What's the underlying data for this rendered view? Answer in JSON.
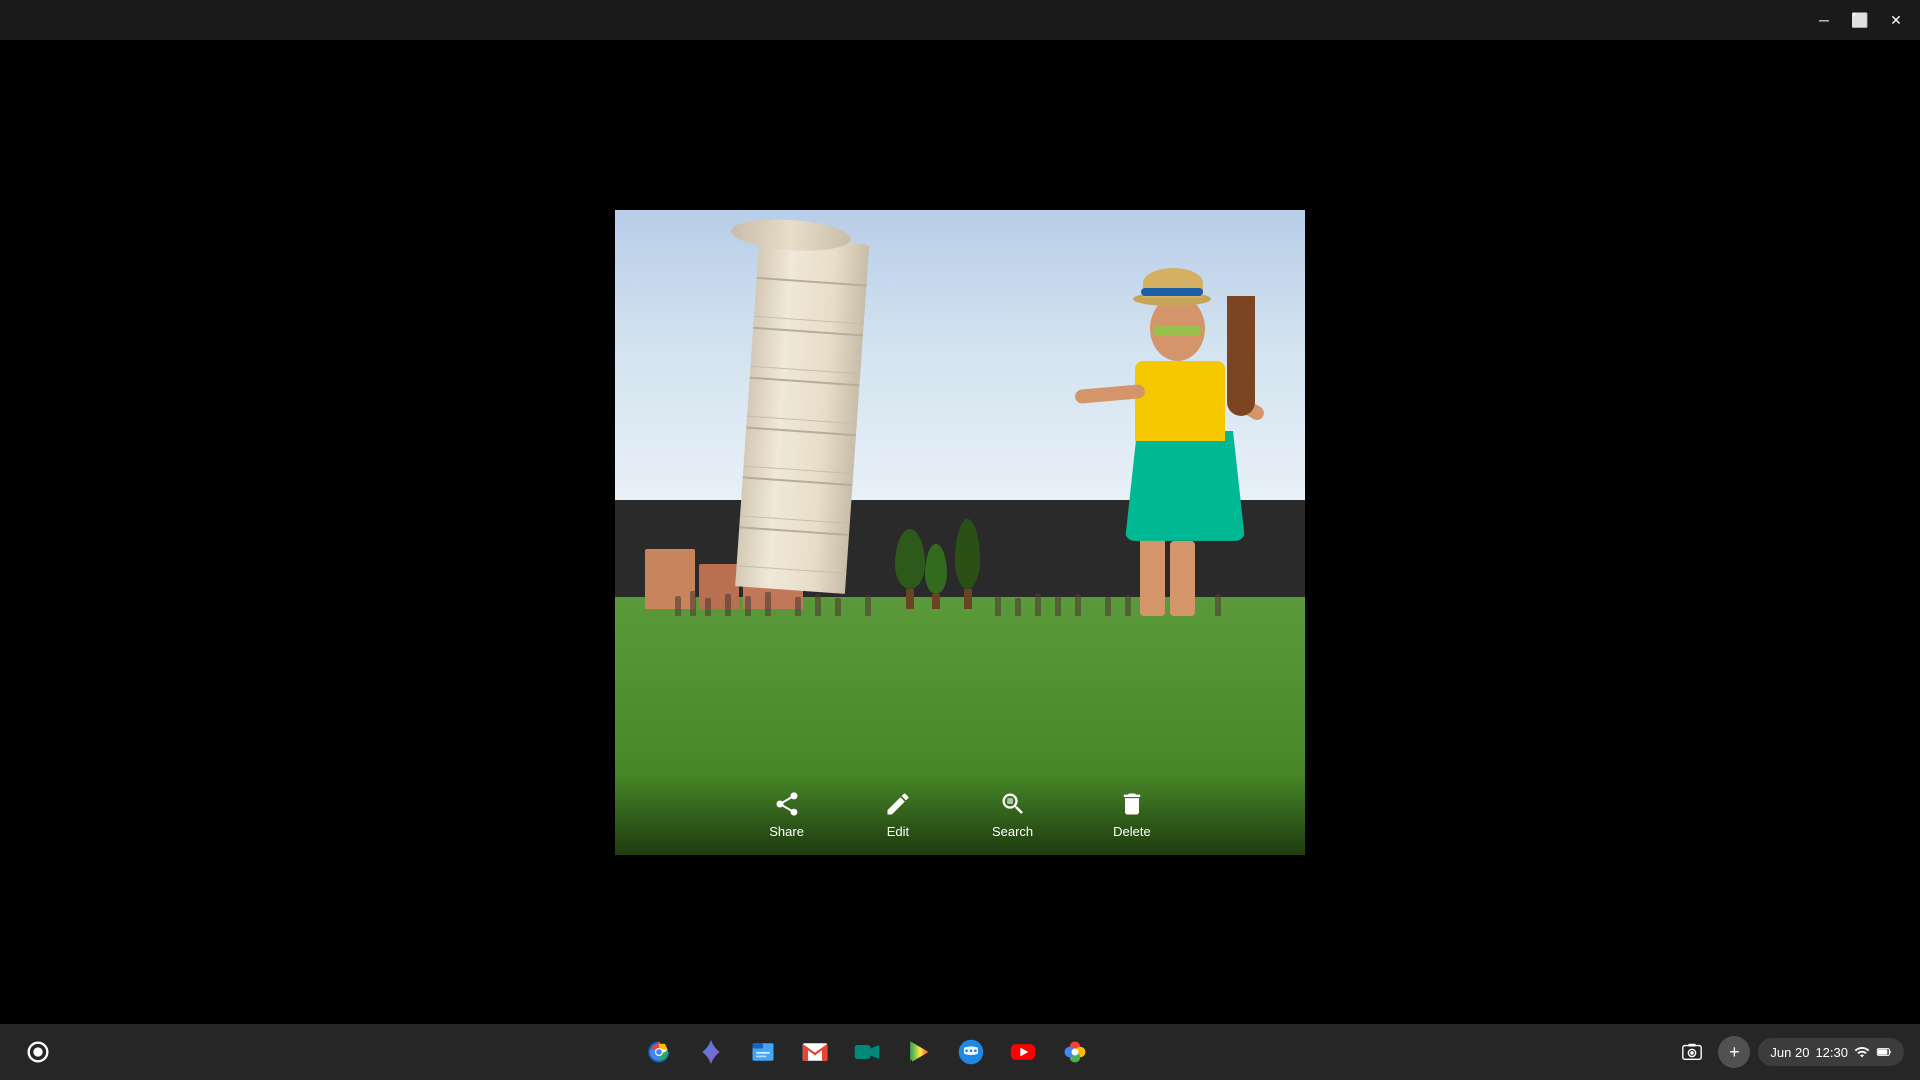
{
  "titlebar": {
    "minimize_label": "─",
    "restore_label": "⬜",
    "close_label": "✕"
  },
  "photo": {
    "alt": "Woman posing with Leaning Tower of Pisa"
  },
  "toolbar": {
    "share": {
      "label": "Share"
    },
    "edit": {
      "label": "Edit"
    },
    "search": {
      "label": "Search"
    },
    "delete": {
      "label": "Delete"
    }
  },
  "taskbar": {
    "apps": [
      {
        "name": "chrome",
        "label": "Google Chrome"
      },
      {
        "name": "gemini",
        "label": "Gemini"
      },
      {
        "name": "files",
        "label": "Files"
      },
      {
        "name": "gmail",
        "label": "Gmail"
      },
      {
        "name": "meet",
        "label": "Google Meet"
      },
      {
        "name": "play",
        "label": "Google Play"
      },
      {
        "name": "messages",
        "label": "Messages"
      },
      {
        "name": "youtube",
        "label": "YouTube"
      },
      {
        "name": "photos",
        "label": "Google Photos"
      }
    ],
    "system": {
      "screenshot": "Screenshot",
      "add": "+",
      "date": "Jun 20",
      "time": "12:30"
    }
  }
}
